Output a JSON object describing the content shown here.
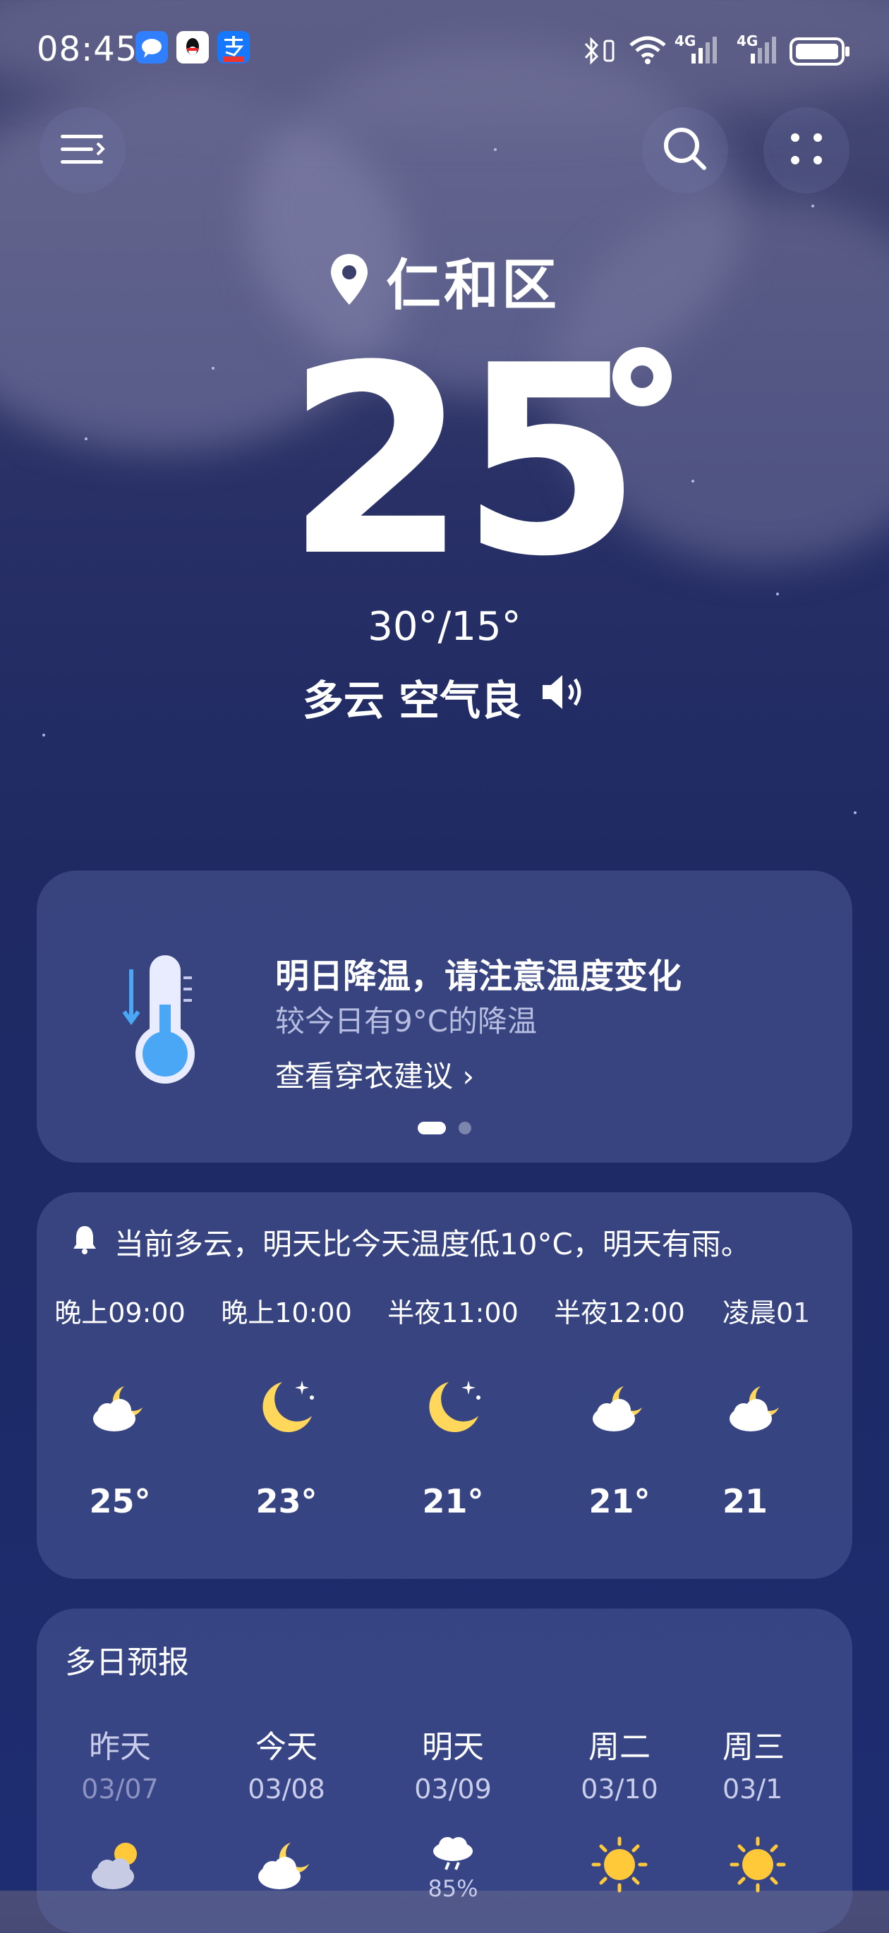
{
  "status_bar": {
    "time": "08:45",
    "notification_icons": [
      "message-icon",
      "qq-icon",
      "alipay-icon"
    ],
    "system_icons": [
      "bluetooth-icon",
      "vibrate-icon",
      "wifi-icon",
      "signal-4g-icon",
      "signal-4g-icon",
      "battery-icon"
    ],
    "signal_label_1": "4G",
    "signal_label_2": "4G"
  },
  "header": {
    "menu_icon": "menu-icon",
    "search_icon": "search-icon",
    "more_icon": "more-icon"
  },
  "location": {
    "name": "仁和区",
    "icon": "location-pin-icon"
  },
  "current": {
    "temperature": "25",
    "range": "30°/15°",
    "condition": "多云 空气良",
    "speaker_icon": "speaker-icon"
  },
  "alert_card": {
    "icon": "thermometer-icon",
    "title": "明日降温，请注意温度变化",
    "subtitle": "较今日有9°C的降温",
    "link": "查看穿衣建议 ›",
    "page_total": 2,
    "page_active": 1
  },
  "hourly": {
    "summary_icon": "bell-icon",
    "summary": "当前多云，明天比今天温度低10°C，明天有雨。",
    "items": [
      {
        "time": "晚上09:00",
        "icon": "partly-cloudy-night-icon",
        "temp": "25°"
      },
      {
        "time": "晚上10:00",
        "icon": "moon-icon",
        "temp": "23°"
      },
      {
        "time": "半夜11:00",
        "icon": "moon-icon",
        "temp": "21°"
      },
      {
        "time": "半夜12:00",
        "icon": "partly-cloudy-night-icon",
        "temp": "21°"
      },
      {
        "time": "凌晨01",
        "icon": "partly-cloudy-night-icon",
        "temp": "21"
      }
    ]
  },
  "multi_day": {
    "title": "多日预报",
    "days": [
      {
        "name": "昨天",
        "date": "03/07",
        "icon": "partly-cloudy-day-icon"
      },
      {
        "name": "今天",
        "date": "03/08",
        "icon": "partly-cloudy-night-icon"
      },
      {
        "name": "明天",
        "date": "03/09",
        "icon": "rain-icon",
        "precip": "85%"
      },
      {
        "name": "周二",
        "date": "03/10",
        "icon": "sunny-icon"
      },
      {
        "name": "周三",
        "date": "03/1",
        "icon": "sunny-icon"
      }
    ]
  },
  "colors": {
    "sun": "#FFC93A",
    "moon": "#FFD75A",
    "accent_blue": "#4AA7F5"
  }
}
